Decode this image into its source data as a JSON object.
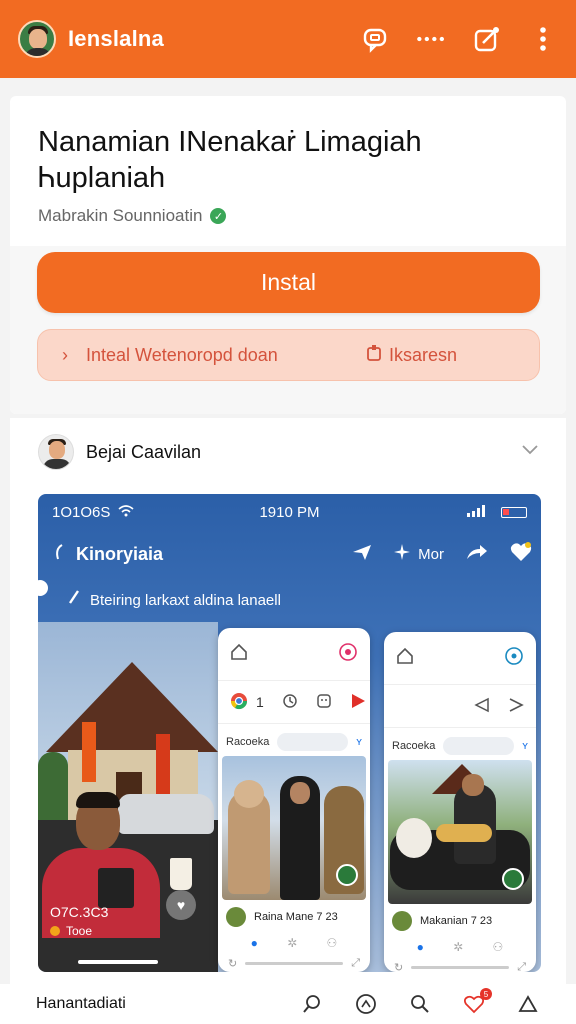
{
  "header": {
    "title": "Ienslalna",
    "icons": [
      "chat-bubble-icon",
      "more-dots-icon",
      "edit-square-icon",
      "kebab-menu-icon"
    ]
  },
  "card": {
    "title": "Nanamian INenakaṙ Limagiah Ꮒuplaniah",
    "subtitle": "Mabrakin Sounnioatin",
    "install_label": "Instal",
    "secondary_left": "Inteal Wetenoropd doan",
    "secondary_right": "Iksaresn"
  },
  "post": {
    "author": "Bejai Caavilan",
    "screenshot": {
      "status_left": "1O1O6S",
      "status_time": "1910 PM",
      "app_title": "Kinoryiaia",
      "action_label": "Mor",
      "search_text": "Bteiring larkaxt aldina lanaell",
      "caption": "O7C.3C3",
      "caption_sub": "Tooe",
      "phone1": {
        "row_count": "1",
        "search_label": "Racoeka",
        "author_line": "Raina Mane 7 23"
      },
      "phone2": {
        "search_label": "Racoeka",
        "author_line": "Makanian 7 23"
      }
    }
  },
  "bottom": {
    "label": "Hanantadiati",
    "badge": "5"
  },
  "colors": {
    "accent": "#f26b22",
    "secondary_bg": "#fbd7c9",
    "verified": "#3aa657"
  }
}
